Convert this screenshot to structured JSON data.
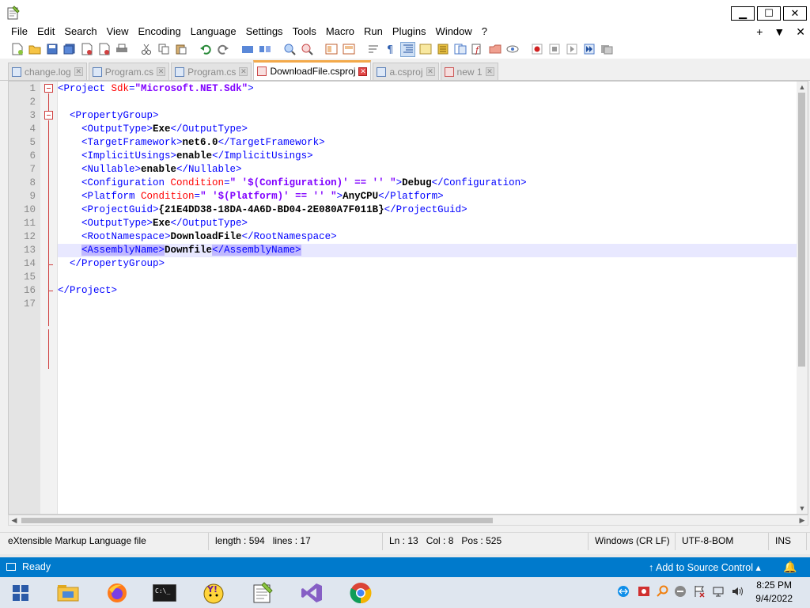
{
  "menu": [
    "File",
    "Edit",
    "Search",
    "View",
    "Encoding",
    "Language",
    "Settings",
    "Tools",
    "Macro",
    "Run",
    "Plugins",
    "Window",
    "?"
  ],
  "menu_right": [
    "+",
    "▼",
    "✕"
  ],
  "window_buttons": {
    "minimize": "▁",
    "maximize": "☐",
    "close": "✕"
  },
  "toolbar_icons": [
    "new-file-icon",
    "open-file-icon",
    "save-icon",
    "save-all-icon",
    "close-icon",
    "close-all-icon",
    "print-icon",
    "cut-icon",
    "copy-icon",
    "paste-icon",
    "undo-icon",
    "redo-icon",
    "find-icon",
    "replace-icon",
    "zoom-in-icon",
    "zoom-out-icon",
    "sync-v-icon",
    "sync-h-icon",
    "word-wrap-icon",
    "show-all-chars-icon",
    "indent-guide-icon",
    "udl-icon",
    "doc-map-icon",
    "function-list-icon",
    "folder-workspace-icon",
    "monitor-icon",
    "record-macro-icon",
    "stop-record-icon",
    "playback-icon",
    "run-multiple-icon",
    "save-macro-icon"
  ],
  "tabs": [
    {
      "label": "change.log",
      "active": false
    },
    {
      "label": "Program.cs",
      "active": false
    },
    {
      "label": "Program.cs",
      "active": false
    },
    {
      "label": "DownloadFile.csproj",
      "active": true
    },
    {
      "label": "a.csproj",
      "active": false
    },
    {
      "label": "new 1",
      "active": false
    }
  ],
  "code_lines": [
    {
      "n": "1"
    },
    {
      "n": "2"
    },
    {
      "n": "3"
    },
    {
      "n": "4"
    },
    {
      "n": "5"
    },
    {
      "n": "6"
    },
    {
      "n": "7"
    },
    {
      "n": "8"
    },
    {
      "n": "9"
    },
    {
      "n": "10"
    },
    {
      "n": "11"
    },
    {
      "n": "12"
    },
    {
      "n": "13"
    },
    {
      "n": "14"
    },
    {
      "n": "15"
    },
    {
      "n": "16"
    },
    {
      "n": "17"
    }
  ],
  "code": {
    "l1_open": "<Project ",
    "l1_attr": "Sdk",
    "l1_eq": "=",
    "l1_val": "\"Microsoft.NET.Sdk\"",
    "l1_close": ">",
    "l3": "<PropertyGroup>",
    "l4_open": "<OutputType>",
    "l4_text": "Exe",
    "l4_close": "</OutputType>",
    "l5_open": "<TargetFramework>",
    "l5_text": "net6.0",
    "l5_close": "</TargetFramework>",
    "l6_open": "<ImplicitUsings>",
    "l6_text": "enable",
    "l6_close": "</ImplicitUsings>",
    "l7_open": "<Nullable>",
    "l7_text": "enable",
    "l7_close": "</Nullable>",
    "l8_open": "<Configuration ",
    "l8_attr": "Condition",
    "l8_eq": "=",
    "l8_val": "\" '$(Configuration)' == '' \"",
    "l8_gt": ">",
    "l8_text": "Debug",
    "l8_close": "</Configuration>",
    "l9_open": "<Platform ",
    "l9_attr": "Condition",
    "l9_eq": "=",
    "l9_val": "\" '$(Platform)' == '' \"",
    "l9_gt": ">",
    "l9_text": "AnyCPU",
    "l9_close": "</Platform>",
    "l10_open": "<ProjectGuid>",
    "l10_text": "{21E4DD38-18DA-4A6D-BD04-2E080A7F011B}",
    "l10_close": "</ProjectGuid>",
    "l11_open": "<OutputType>",
    "l11_text": "Exe",
    "l11_close": "</OutputType>",
    "l12_open": "<RootNamespace>",
    "l12_text": "DownloadFile",
    "l12_close": "</RootNamespace>",
    "l13_open": "<AssemblyName>",
    "l13_text": "Downfile",
    "l13_close": "</AssemblyName>",
    "l14": "</PropertyGroup>",
    "l16": "</Project>"
  },
  "status": {
    "file_type": "eXtensible Markup Language file",
    "length": "length : 594",
    "lines": "lines : 17",
    "ln": "Ln : 13",
    "col": "Col : 8",
    "pos": "Pos : 525",
    "eol": "Windows (CR LF)",
    "encoding": "UTF-8-BOM",
    "mode": "INS"
  },
  "vs_status": {
    "ready": "Ready",
    "source_control": "Add to Source Control"
  },
  "taskbar": {
    "apps": [
      "start-icon",
      "file-explorer-icon",
      "firefox-icon",
      "terminal-icon",
      "yahoo-icon",
      "notepadpp-icon",
      "visual-studio-icon",
      "chrome-icon"
    ],
    "time": "8:25 PM",
    "date": "9/4/2022"
  },
  "colors": {
    "accent": "#007acc",
    "tag": "#0000ff",
    "attr": "#ff0000",
    "attr_value": "#8000ff",
    "highlight": "#c0b8ff"
  }
}
